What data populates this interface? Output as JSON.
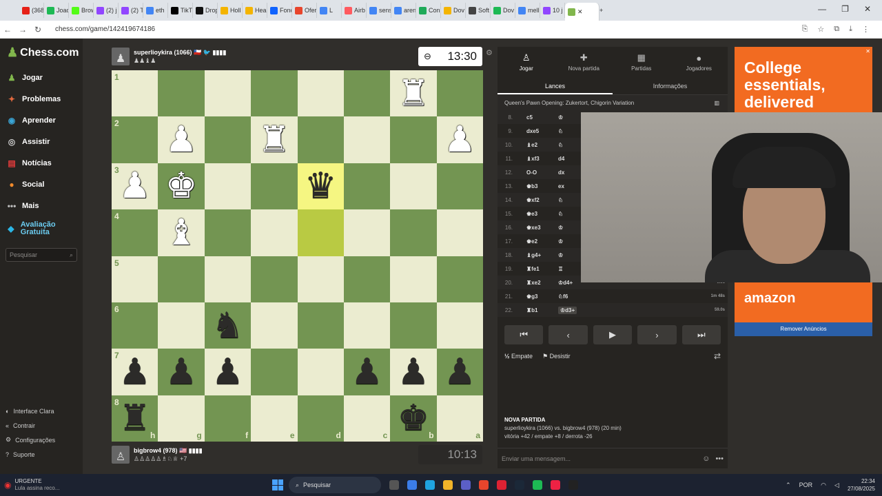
{
  "browser": {
    "tabs": [
      {
        "label": "(368",
        "color": "#e62117"
      },
      {
        "label": "Joao",
        "color": "#1db954"
      },
      {
        "label": "Brow",
        "color": "#53fc18"
      },
      {
        "label": "(2) j",
        "color": "#9146ff"
      },
      {
        "label": "(2) T",
        "color": "#9146ff"
      },
      {
        "label": "eth",
        "color": "#4285f4"
      },
      {
        "label": "TikT",
        "color": "#010101"
      },
      {
        "label": "Drop",
        "color": "#111111"
      },
      {
        "label": "Holl",
        "color": "#f4b400"
      },
      {
        "label": "Hea",
        "color": "#f4b400"
      },
      {
        "label": "Fonc",
        "color": "#0f62fe"
      },
      {
        "label": "Ofer",
        "color": "#e8452c"
      },
      {
        "label": "L",
        "color": "#4285f4"
      },
      {
        "label": "Airb",
        "color": "#ff5a5f"
      },
      {
        "label": "sens",
        "color": "#4285f4"
      },
      {
        "label": "aren",
        "color": "#4285f4"
      },
      {
        "label": "Con",
        "color": "#1faa59"
      },
      {
        "label": "Dov",
        "color": "#f4b400"
      },
      {
        "label": "Soft",
        "color": "#444444"
      },
      {
        "label": "Dov",
        "color": "#1db954"
      },
      {
        "label": "mell",
        "color": "#4285f4"
      },
      {
        "label": "10 j",
        "color": "#9146ff"
      }
    ],
    "url": "chess.com/game/142419674186"
  },
  "sidebar": {
    "logo": "Chess.com",
    "items": [
      {
        "label": "Jogar",
        "icon": "pawn-icon",
        "glyph": "♟",
        "color": "#81b64c"
      },
      {
        "label": "Problemas",
        "icon": "puzzle-icon",
        "glyph": "✦",
        "color": "#e3693e"
      },
      {
        "label": "Aprender",
        "icon": "learn-icon",
        "glyph": "◉",
        "color": "#3aa5d6"
      },
      {
        "label": "Assistir",
        "icon": "watch-icon",
        "glyph": "◎",
        "color": "#d0d0d0"
      },
      {
        "label": "Notícias",
        "icon": "news-icon",
        "glyph": "▤",
        "color": "#e33b3b"
      },
      {
        "label": "Social",
        "icon": "social-icon",
        "glyph": "●",
        "color": "#f08a2c"
      },
      {
        "label": "Mais",
        "icon": "more-icon",
        "glyph": "•••",
        "color": "#bbbbbb"
      },
      {
        "label": "Avaliação Gratuita",
        "icon": "diamond-icon",
        "glyph": "◆",
        "color": "#2bb6e6"
      }
    ],
    "search_placeholder": "Pesquisar",
    "bottom": [
      {
        "label": "Interface Clara",
        "glyph": "◐"
      },
      {
        "label": "Contrair",
        "glyph": "«"
      },
      {
        "label": "Configurações",
        "glyph": "⚙"
      },
      {
        "label": "Suporte",
        "glyph": "?"
      }
    ]
  },
  "top_player": {
    "name": "superlioykira (1066)",
    "flags": "🇨🇱 🐦 ▮▮▮▮",
    "captured": "♟♟♝♟",
    "clock": "13:30"
  },
  "bottom_player": {
    "name": "bigbrow4 (978)",
    "flags": "🇺🇸 ▮▮▮▮",
    "captured": "♙♙♙♙♙♗♘♕",
    "advantage": "+7",
    "clock": "10:13"
  },
  "board": {
    "rank_labels": [
      "1",
      "2",
      "3",
      "4",
      "5",
      "6",
      "7",
      "8"
    ],
    "file_labels": [
      "h",
      "g",
      "f",
      "e",
      "d",
      "c",
      "b",
      "a"
    ],
    "highlights": [
      [
        2,
        4
      ],
      [
        3,
        4
      ]
    ],
    "pieces": [
      {
        "row": 0,
        "col": 6,
        "glyph": "♜",
        "side": "w"
      },
      {
        "row": 1,
        "col": 1,
        "glyph": "♟",
        "side": "w"
      },
      {
        "row": 1,
        "col": 3,
        "glyph": "♜",
        "side": "w"
      },
      {
        "row": 1,
        "col": 7,
        "glyph": "♟",
        "side": "w"
      },
      {
        "row": 2,
        "col": 0,
        "glyph": "♟",
        "side": "w"
      },
      {
        "row": 2,
        "col": 1,
        "glyph": "♚",
        "side": "w"
      },
      {
        "row": 2,
        "col": 4,
        "glyph": "♛",
        "side": "b"
      },
      {
        "row": 3,
        "col": 1,
        "glyph": "♝",
        "side": "w"
      },
      {
        "row": 5,
        "col": 2,
        "glyph": "♞",
        "side": "b"
      },
      {
        "row": 6,
        "col": 0,
        "glyph": "♟",
        "side": "b"
      },
      {
        "row": 6,
        "col": 1,
        "glyph": "♟",
        "side": "b"
      },
      {
        "row": 6,
        "col": 2,
        "glyph": "♟",
        "side": "b"
      },
      {
        "row": 6,
        "col": 5,
        "glyph": "♟",
        "side": "b"
      },
      {
        "row": 6,
        "col": 6,
        "glyph": "♟",
        "side": "b"
      },
      {
        "row": 6,
        "col": 7,
        "glyph": "♟",
        "side": "b"
      },
      {
        "row": 7,
        "col": 0,
        "glyph": "♜",
        "side": "b"
      },
      {
        "row": 7,
        "col": 6,
        "glyph": "♚",
        "side": "b"
      }
    ]
  },
  "panel": {
    "tabs": [
      {
        "label": "Jogar",
        "icon": "♙"
      },
      {
        "label": "Nova partida",
        "icon": "✚"
      },
      {
        "label": "Partidas",
        "icon": "▦"
      },
      {
        "label": "Jogadores",
        "icon": "●"
      }
    ],
    "subtabs": [
      "Lances",
      "Informações"
    ],
    "opening": "Queen's Pawn Opening: Zukertort, Chigorin Variation",
    "moves": [
      {
        "no": "8.",
        "w": "c5",
        "b": "♔"
      },
      {
        "no": "9.",
        "w": "dxe5",
        "b": "♘"
      },
      {
        "no": "10.",
        "w": "♝e2",
        "b": "♘"
      },
      {
        "no": "11.",
        "w": "♝xf3",
        "b": "d4"
      },
      {
        "no": "12.",
        "w": "O-O",
        "b": "dx"
      },
      {
        "no": "13.",
        "w": "♚b3",
        "b": "ex"
      },
      {
        "no": "14.",
        "w": "♚xf2",
        "b": "♘"
      },
      {
        "no": "15.",
        "w": "♚e3",
        "b": "♘"
      },
      {
        "no": "16.",
        "w": "♚xe3",
        "b": "♔"
      },
      {
        "no": "17.",
        "w": "♚e2",
        "b": "♔"
      },
      {
        "no": "18.",
        "w": "♝g4+",
        "b": "♔"
      },
      {
        "no": "19.",
        "w": "♜fe1",
        "b": "♖"
      },
      {
        "no": "20.",
        "w": "♜xe2",
        "b": "♔d4+",
        "time": "0.9s"
      },
      {
        "no": "21.",
        "w": "♚g3",
        "b": "♘f6",
        "time": "1m 48s"
      },
      {
        "no": "22.",
        "w": "♜b1",
        "b": "♔d3+",
        "time": "59.0s",
        "current": true
      }
    ],
    "controls": [
      "⏮",
      "‹",
      "▶",
      "›",
      "⏭"
    ],
    "draw": "Empate",
    "resign": "Desistir",
    "summary_title": "NOVA PARTIDA",
    "summary_line": "superlioykira (1066) vs. bigbrow4 (978) (20 min)",
    "summary_stats": "vitória +42 / empate +8 / derrota -26",
    "chat_placeholder": "Enviar uma mensagem..."
  },
  "ad": {
    "headline": "College essentials, delivered",
    "brand": "amazon",
    "remove": "Remover Anúncios"
  },
  "taskbar": {
    "window_title": "URGENTE",
    "window_sub": "Lula assina reco...",
    "search": "Pesquisar",
    "lang": "POR",
    "time": "22:34",
    "date": "27/08/2025"
  }
}
